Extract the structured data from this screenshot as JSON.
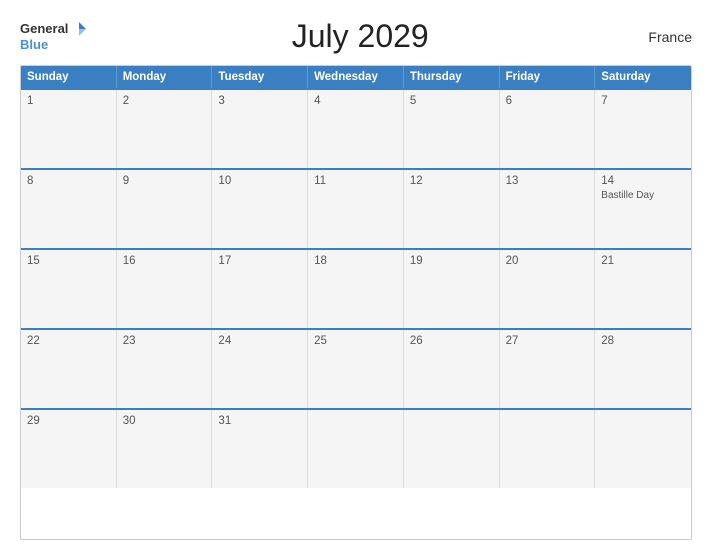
{
  "header": {
    "title": "July 2029",
    "country": "France",
    "logo_general": "General",
    "logo_blue": "Blue"
  },
  "calendar": {
    "days_of_week": [
      "Sunday",
      "Monday",
      "Tuesday",
      "Wednesday",
      "Thursday",
      "Friday",
      "Saturday"
    ],
    "weeks": [
      [
        {
          "day": 1,
          "events": []
        },
        {
          "day": 2,
          "events": []
        },
        {
          "day": 3,
          "events": []
        },
        {
          "day": 4,
          "events": []
        },
        {
          "day": 5,
          "events": []
        },
        {
          "day": 6,
          "events": []
        },
        {
          "day": 7,
          "events": []
        }
      ],
      [
        {
          "day": 8,
          "events": []
        },
        {
          "day": 9,
          "events": []
        },
        {
          "day": 10,
          "events": []
        },
        {
          "day": 11,
          "events": []
        },
        {
          "day": 12,
          "events": []
        },
        {
          "day": 13,
          "events": []
        },
        {
          "day": 14,
          "events": [
            "Bastille Day"
          ]
        }
      ],
      [
        {
          "day": 15,
          "events": []
        },
        {
          "day": 16,
          "events": []
        },
        {
          "day": 17,
          "events": []
        },
        {
          "day": 18,
          "events": []
        },
        {
          "day": 19,
          "events": []
        },
        {
          "day": 20,
          "events": []
        },
        {
          "day": 21,
          "events": []
        }
      ],
      [
        {
          "day": 22,
          "events": []
        },
        {
          "day": 23,
          "events": []
        },
        {
          "day": 24,
          "events": []
        },
        {
          "day": 25,
          "events": []
        },
        {
          "day": 26,
          "events": []
        },
        {
          "day": 27,
          "events": []
        },
        {
          "day": 28,
          "events": []
        }
      ],
      [
        {
          "day": 29,
          "events": []
        },
        {
          "day": 30,
          "events": []
        },
        {
          "day": 31,
          "events": []
        },
        {
          "day": null,
          "events": []
        },
        {
          "day": null,
          "events": []
        },
        {
          "day": null,
          "events": []
        },
        {
          "day": null,
          "events": []
        }
      ]
    ]
  }
}
